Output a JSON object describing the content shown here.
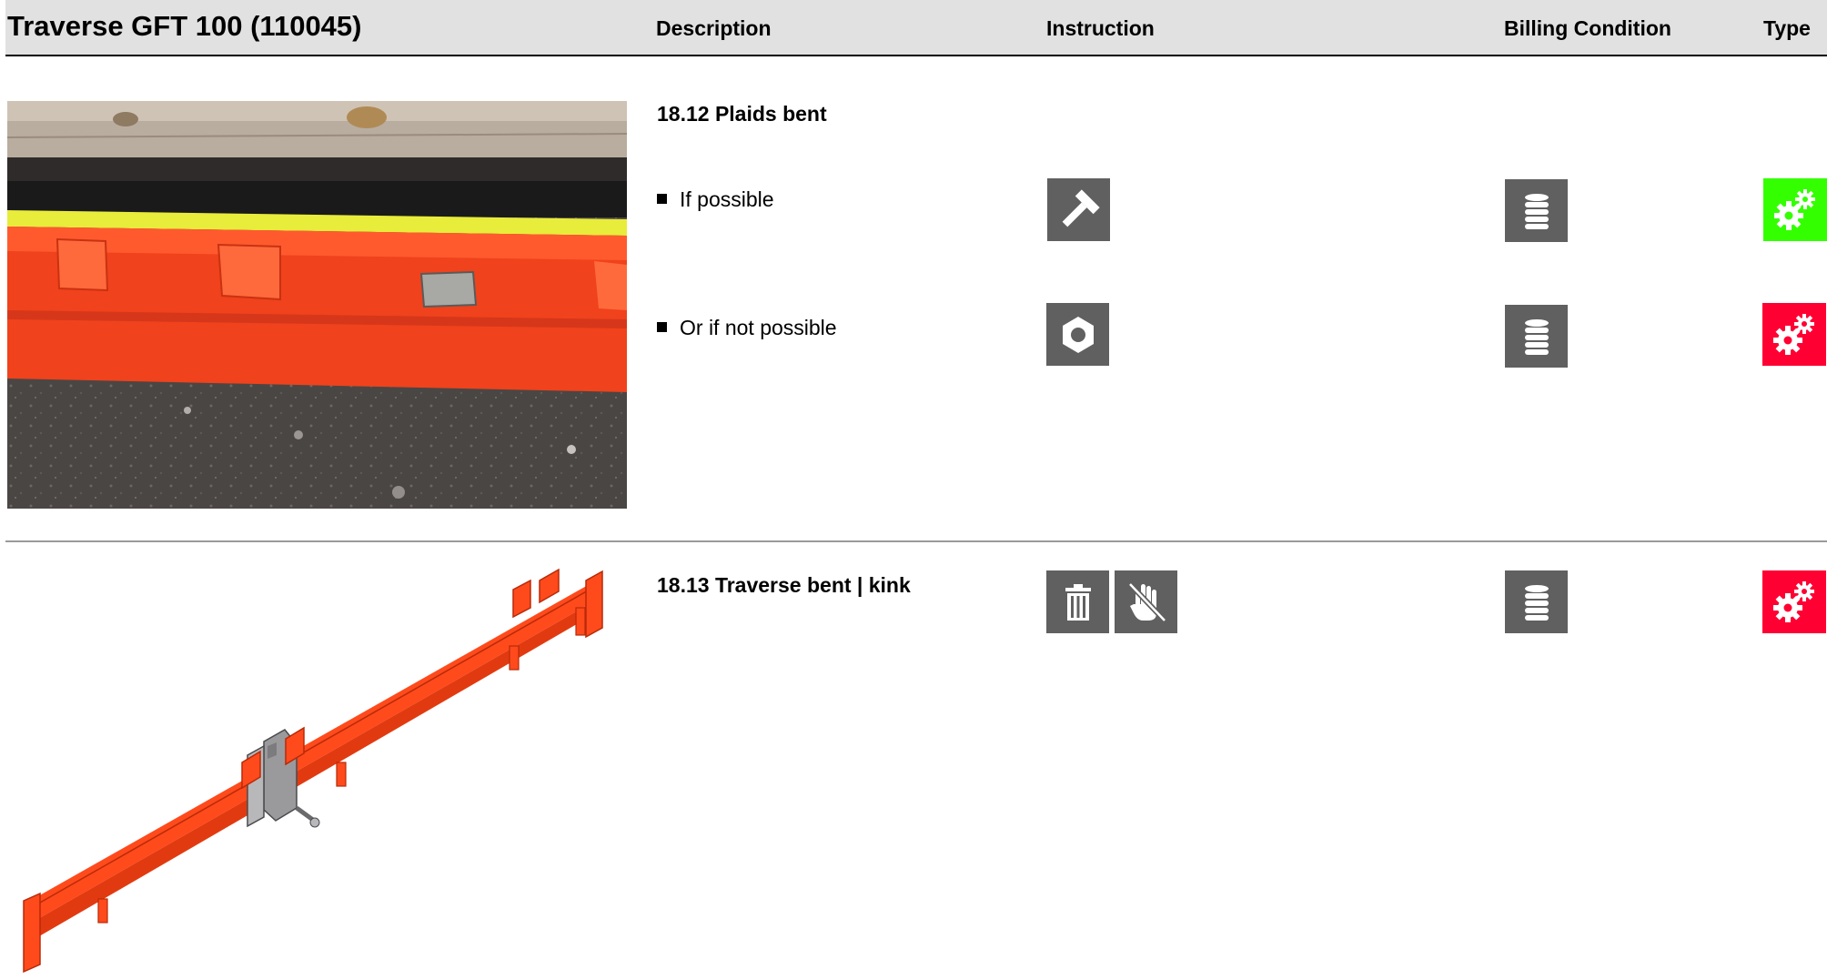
{
  "header": {
    "title": "Traverse GFT 100 (110045)",
    "col_description": "Description",
    "col_instruction": "Instruction",
    "col_billing": "Billing Condition",
    "col_type": "Type"
  },
  "sections": [
    {
      "title": "18.12 Plaids bent",
      "rows": [
        {
          "text": "If possible",
          "instruction_icons": [
            "hammer-icon"
          ],
          "billing_icon": "coin-stack-icon",
          "type_icon": "gears-icon",
          "type_color": "#33ff00"
        },
        {
          "text": "Or if not possible",
          "instruction_icons": [
            "hex-nut-icon"
          ],
          "billing_icon": "coin-stack-icon",
          "type_icon": "gears-icon",
          "type_color": "#ff0033"
        }
      ]
    },
    {
      "title": "18.13 Traverse bent | kink",
      "rows": [
        {
          "text": "",
          "instruction_icons": [
            "trash-icon",
            "no-touch-hand-icon"
          ],
          "billing_icon": "coin-stack-icon",
          "type_icon": "gears-icon",
          "type_color": "#ff0033"
        }
      ]
    }
  ],
  "colors": {
    "header_bg": "#e1e1e1",
    "icon_bg": "#606060",
    "type_green": "#33ff00",
    "type_red": "#ff0033",
    "beam_orange": "#ff4a1c"
  }
}
